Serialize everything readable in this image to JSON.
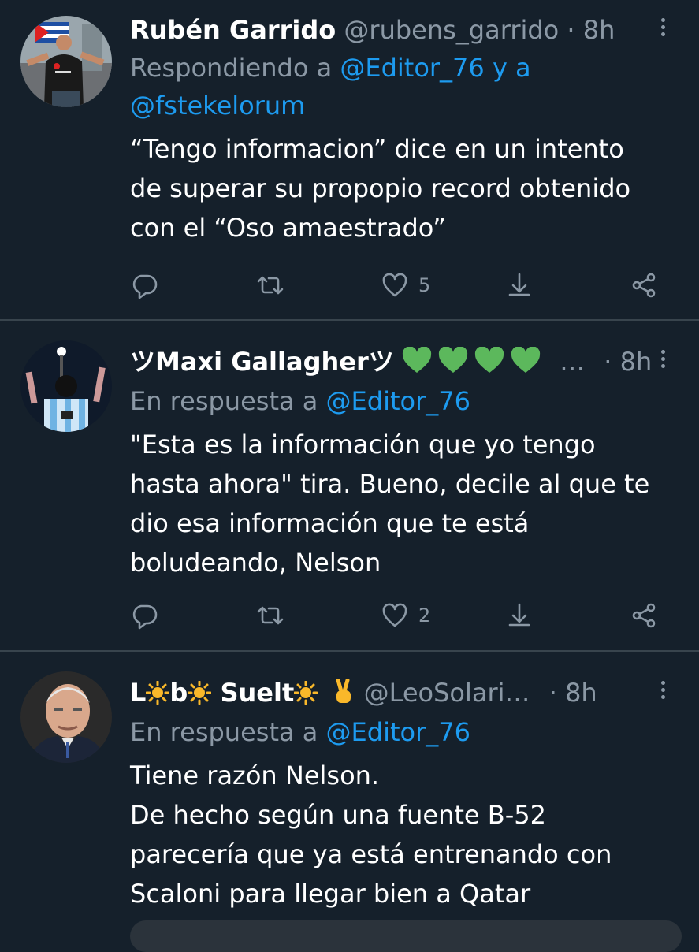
{
  "colors": {
    "background": "#15202b",
    "text_primary": "#ffffff",
    "text_secondary": "#8b98a5",
    "link": "#1d9bf0",
    "divider": "#38444d",
    "heart_green": "#5cb85c",
    "sun_yellow": "#f9b82a"
  },
  "tweets": [
    {
      "name": "Rubén Garrido",
      "handle": "@rubens_garrido",
      "dot": "·",
      "time": "8h",
      "reply_prefix": "Respondiendo a",
      "reply_mention_1": "@Editor_76",
      "reply_and": "y a",
      "reply_mention_2": "@fstekelorum",
      "text_lines": [
        "“Tengo informacion” dice en un intento",
        "de superar su propopio record obtenido",
        "con el “Oso amaestrado”"
      ],
      "likes": "5",
      "avatar_icon": "avatar-person-red-shirt"
    },
    {
      "name": "ツMaxi Gallagherツ",
      "name_emoji": "green-heart-icon x4",
      "ellipsis": "…",
      "dot": "·",
      "time": "8h",
      "reply_prefix": "En respuesta a",
      "reply_mention_1": "@Editor_76",
      "text_lines": [
        "\"Esta es la información que yo tengo",
        "hasta ahora\" tira. Bueno, decile al que te",
        "dio esa información que te está",
        "boludeando, Nelson"
      ],
      "likes": "2",
      "avatar_icon": "avatar-argentina-jersey"
    },
    {
      "name_part_1": "L",
      "name_part_2": "b",
      "name_part_3": " Suelt",
      "handle": "@LeoSolari…",
      "dot": "·",
      "time": "8h",
      "reply_prefix": "En respuesta a",
      "reply_mention_1": "@Editor_76",
      "text_lines": [
        "Tiene razón Nelson.",
        "De hecho según una fuente B-52",
        "parecería que ya está entrenando con",
        "Scaloni para llegar bien a Qatar"
      ],
      "avatar_icon": "avatar-elderly-man"
    }
  ],
  "action_icons": [
    "reply-icon",
    "retweet-icon",
    "like-icon",
    "download-share-icon",
    "share-icon"
  ]
}
